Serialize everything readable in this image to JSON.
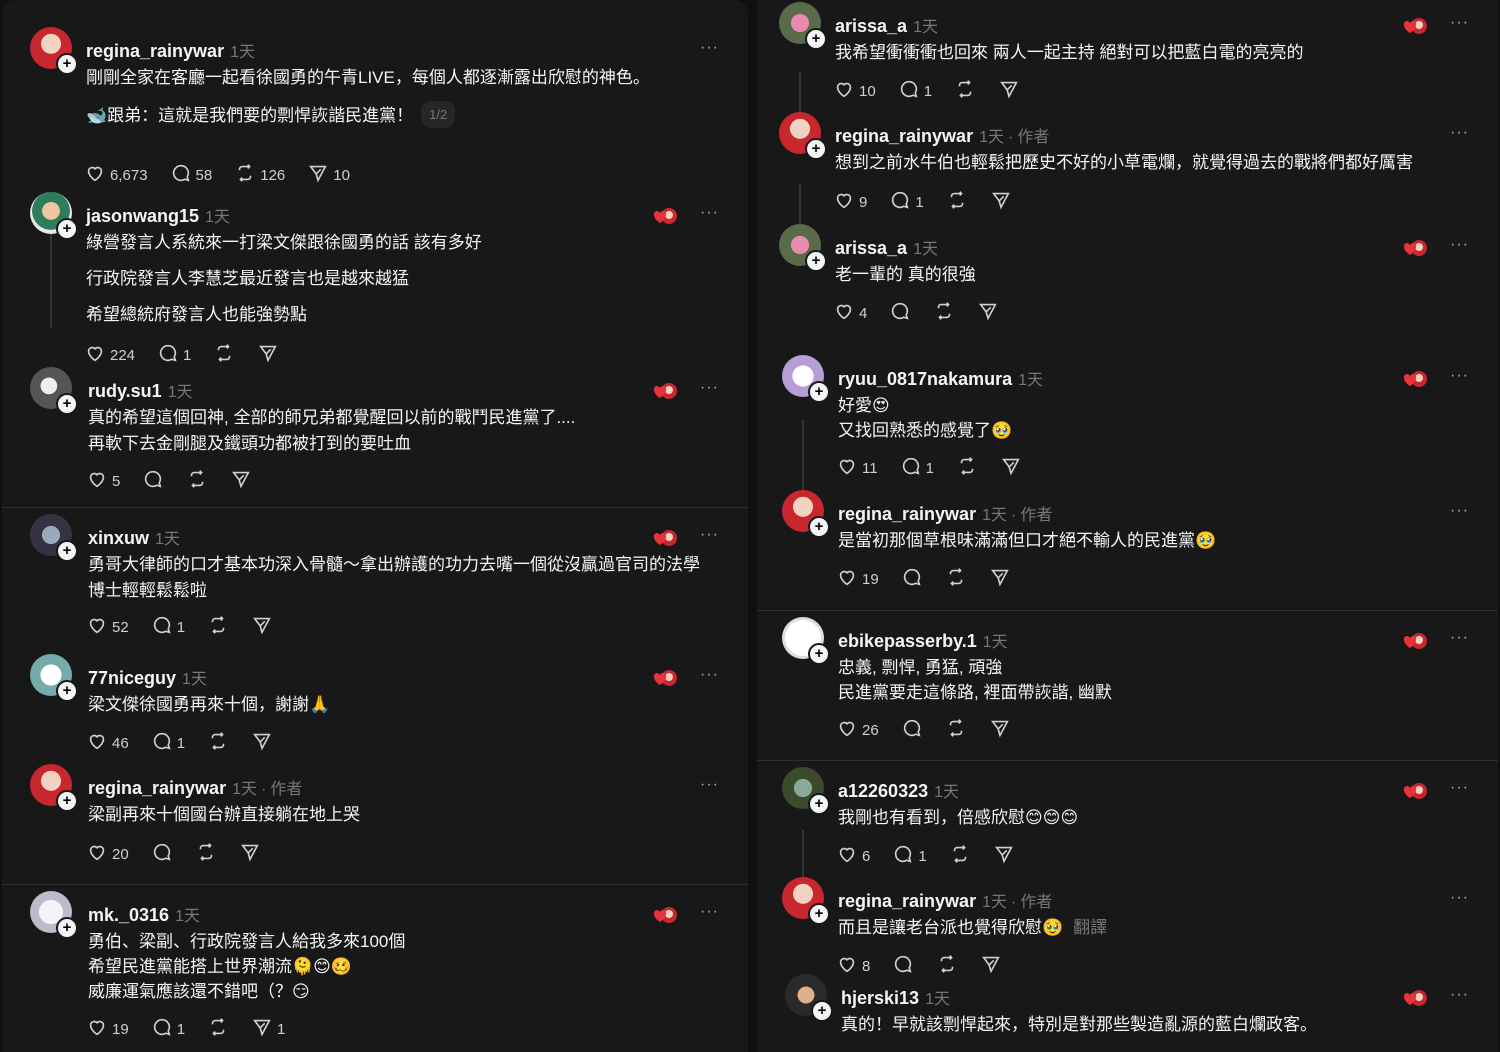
{
  "colors": {
    "background": "#181818",
    "text": "#f3f5f7",
    "muted": "#777777",
    "reaction_heart": "#e8323c"
  },
  "icons": {
    "like": "heart-icon",
    "reply": "comment-icon",
    "repost": "repost-icon",
    "share": "send-icon",
    "more": "more-icon"
  },
  "left": [
    {
      "username": "regina_rainywar",
      "time": "1天",
      "lines": [
        "剛剛全家在客廳一起看徐國勇的午青LIVE，每個人都逐漸露出欣慰的神色。",
        "🐋跟弟：這就是我們要的剽悍詼諧民進黨！"
      ],
      "pager": "1/2",
      "likes": "6,673",
      "replies": "58",
      "reposts": "126",
      "shares": "10"
    },
    {
      "username": "jasonwang15",
      "time": "1天",
      "lines": [
        "綠營發言人系統來一打梁文傑跟徐國勇的話 該有多好",
        "行政院發言人李慧芝最近發言也是越來越猛",
        "希望總統府發言人也能強勢點"
      ],
      "likes": "224",
      "replies": "1"
    },
    {
      "username": "rudy.su1",
      "time": "1天",
      "lines": [
        "真的希望這個回神, 全部的師兄弟都覺醒回以前的戰鬥民進黨了....",
        "再軟下去金剛腿及鐵頭功都被打到的要吐血"
      ],
      "likes": "5"
    },
    {
      "username": "xinxuw",
      "time": "1天",
      "lines": [
        "勇哥大律師的口才基本功深入骨髓～拿出辦護的功力去嘴一個從沒贏過官司的法學",
        "博士輕輕鬆鬆啦"
      ],
      "likes": "52",
      "replies": "1"
    },
    {
      "username": "77niceguy",
      "time": "1天",
      "lines": [
        "梁文傑徐國勇再來十個，謝謝🙏"
      ],
      "likes": "46",
      "replies": "1"
    },
    {
      "username": "regina_rainywar",
      "time": "1天",
      "author": "作者",
      "lines": [
        "梁副再來十個國台辦直接躺在地上哭"
      ],
      "likes": "20"
    },
    {
      "username": "mk._0316",
      "time": "1天",
      "lines": [
        "勇伯、梁副、行政院發言人給我多來100個",
        "希望民進黨能搭上世界潮流🫠😊🥴",
        "威廉運氣應該還不錯吧（？😏"
      ],
      "likes": "19",
      "replies": "1",
      "shares": "1"
    }
  ],
  "right": [
    {
      "username": "arissa_a",
      "time": "1天",
      "lines": [
        "我希望衝衝衝也回來 兩人一起主持 絕對可以把藍白電的亮亮的"
      ],
      "likes": "10",
      "replies": "1"
    },
    {
      "username": "regina_rainywar",
      "time": "1天",
      "author": "作者",
      "lines": [
        "想到之前水牛伯也輕鬆把歷史不好的小草電爛，就覺得過去的戰將們都好厲害"
      ],
      "likes": "9",
      "replies": "1"
    },
    {
      "username": "arissa_a",
      "time": "1天",
      "lines": [
        "老一輩的 真的很強"
      ],
      "likes": "4"
    },
    {
      "username": "ryuu_0817nakamura",
      "time": "1天",
      "lines": [
        "好愛😍",
        "又找回熟悉的感覺了🥹"
      ],
      "likes": "11",
      "replies": "1"
    },
    {
      "username": "regina_rainywar",
      "time": "1天",
      "author": "作者",
      "lines": [
        "是當初那個草根味滿滿但口才絕不輸人的民進黨🥹"
      ],
      "likes": "19"
    },
    {
      "username": "ebikepasserby.1",
      "time": "1天",
      "lines": [
        "忠義, 剽悍, 勇猛, 頑強",
        "民進黨要走這條路, 裡面帶詼諧, 幽默"
      ],
      "likes": "26"
    },
    {
      "username": "a12260323",
      "time": "1天",
      "lines": [
        "我剛也有看到，倍感欣慰😊😊😊"
      ],
      "likes": "6",
      "replies": "1"
    },
    {
      "username": "regina_rainywar",
      "time": "1天",
      "author": "作者",
      "lines": [
        "而且是讓老台派也覺得欣慰🥹"
      ],
      "translate": "翻譯",
      "likes": "8"
    },
    {
      "username": "hjerski13",
      "time": "1天",
      "lines": [
        "真的！早就該剽悍起來，特別是對那些製造亂源的藍白爛政客。"
      ]
    }
  ]
}
